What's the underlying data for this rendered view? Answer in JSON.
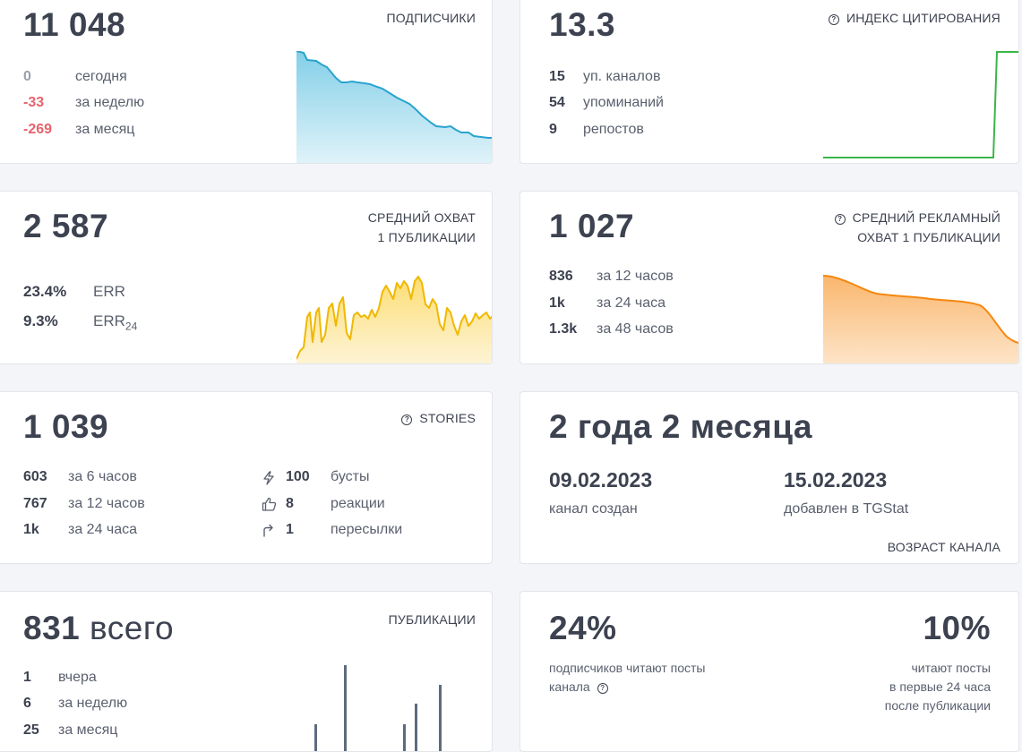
{
  "subscribers": {
    "value": "11 048",
    "title": "ПОДПИСЧИКИ",
    "rows": [
      {
        "num": "0",
        "label": "сегодня"
      },
      {
        "num": "-33",
        "label": "за неделю"
      },
      {
        "num": "-269",
        "label": "за месяц"
      }
    ],
    "chart_color": "#2aa3cf"
  },
  "citation": {
    "value": "13.3",
    "title": "ИНДЕКС ЦИТИРОВАНИЯ",
    "rows": [
      {
        "num": "15",
        "label": "уп. каналов"
      },
      {
        "num": "54",
        "label": "упоминаний"
      },
      {
        "num": "9",
        "label": "репостов"
      }
    ],
    "chart_color": "#3cb64a"
  },
  "avg_reach": {
    "value": "2 587",
    "title_line1": "СРЕДНИЙ ОХВАТ",
    "title_line2": "1 ПУБЛИКАЦИИ",
    "err_value": "23.4%",
    "err_label": "ERR",
    "err24_value": "9.3%",
    "err24_label": "ERR",
    "err24_sub": "24",
    "chart_color": "#f0b800"
  },
  "ad_reach": {
    "value": "1 027",
    "title_line1": "СРЕДНИЙ РЕКЛАМНЫЙ",
    "title_line2": "ОХВАТ 1 ПУБЛИКАЦИИ",
    "rows": [
      {
        "num": "836",
        "label": "за 12 часов"
      },
      {
        "num": "1k",
        "label": "за 24 часа"
      },
      {
        "num": "1.3k",
        "label": "за 48 часов"
      }
    ],
    "chart_color": "#f5870f"
  },
  "stories": {
    "value": "1 039",
    "title": "STORIES",
    "rows": [
      {
        "num": "603",
        "label": "за 6 часов"
      },
      {
        "num": "767",
        "label": "за 12 часов"
      },
      {
        "num": "1k",
        "label": "за 24 часа"
      }
    ],
    "right_rows": [
      {
        "icon": "lightning-icon",
        "num": "100",
        "label": "бусты"
      },
      {
        "icon": "thumbs-up-icon",
        "num": "8",
        "label": "реакции"
      },
      {
        "icon": "forward-arrow-icon",
        "num": "1",
        "label": "пересылки"
      }
    ]
  },
  "channel_age": {
    "value": "2 года 2 месяца",
    "created_date": "09.02.2023",
    "created_label": "канал создан",
    "added_date": "15.02.2023",
    "added_label": "добавлен в TGStat",
    "title": "ВОЗРАСТ КАНАЛА"
  },
  "publications": {
    "value": "831",
    "value_suffix": "всего",
    "title": "ПУБЛИКАЦИИ",
    "rows": [
      {
        "num": "1",
        "label": "вчера"
      },
      {
        "num": "6",
        "label": "за неделю"
      },
      {
        "num": "25",
        "label": "за месяц"
      }
    ],
    "chart_color": "#5d6b7e"
  },
  "readers": {
    "left_value": "24%",
    "left_line1": "подписчиков читают посты",
    "left_line2": "канала",
    "right_value": "10%",
    "right_line1": "читают посты",
    "right_line2": "в первые 24 часа",
    "right_line3": "после публикации"
  }
}
